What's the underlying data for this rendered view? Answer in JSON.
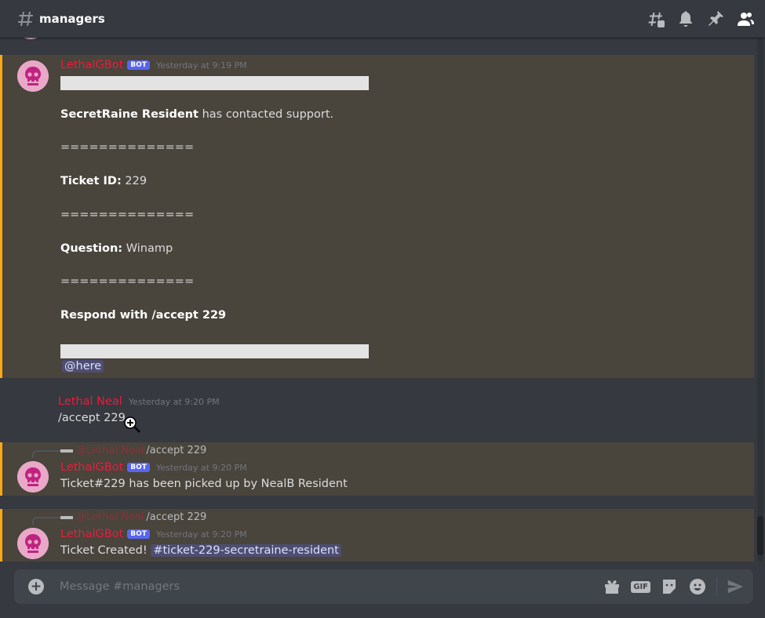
{
  "channel": {
    "name": "managers"
  },
  "messages": [
    {
      "author": "LethalGBot",
      "bot_tag": "BOT",
      "timestamp": "Yesterday at 9:19 PM",
      "contact_name": "SecretRaine Resident",
      "contact_text": " has contacted support.",
      "separator": "==============",
      "ticket_label": "Ticket ID:",
      "ticket_value": " 229",
      "question_label": "Question:",
      "question_value": " Winamp",
      "respond": "Respond with /accept 229",
      "mention": "@here"
    },
    {
      "author": "Lethal Neal",
      "timestamp": "Yesterday at 9:20 PM",
      "text": "/accept 229"
    },
    {
      "reply_author": "@Lethal Neal",
      "reply_text": "/accept 229",
      "author": "LethalGBot",
      "bot_tag": "BOT",
      "timestamp": "Yesterday at 9:20 PM",
      "text": "Ticket#229 has been picked up by NealB Resident"
    },
    {
      "reply_author": "@Lethal Neal",
      "reply_text": "/accept 229",
      "author": "LethalGBot",
      "bot_tag": "BOT",
      "timestamp": "Yesterday at 9:20 PM",
      "text": "Ticket Created! ",
      "channel_link": "ticket-229-secretraine-resident"
    }
  ],
  "composer": {
    "placeholder": "Message #managers"
  },
  "composer_icons": {
    "gif_label": "GIF"
  },
  "colors": {
    "mention_bg": "#49443c",
    "mention_border": "#faa81a",
    "author_red": "#ed1a3b",
    "bot_tag": "#5865f2"
  }
}
